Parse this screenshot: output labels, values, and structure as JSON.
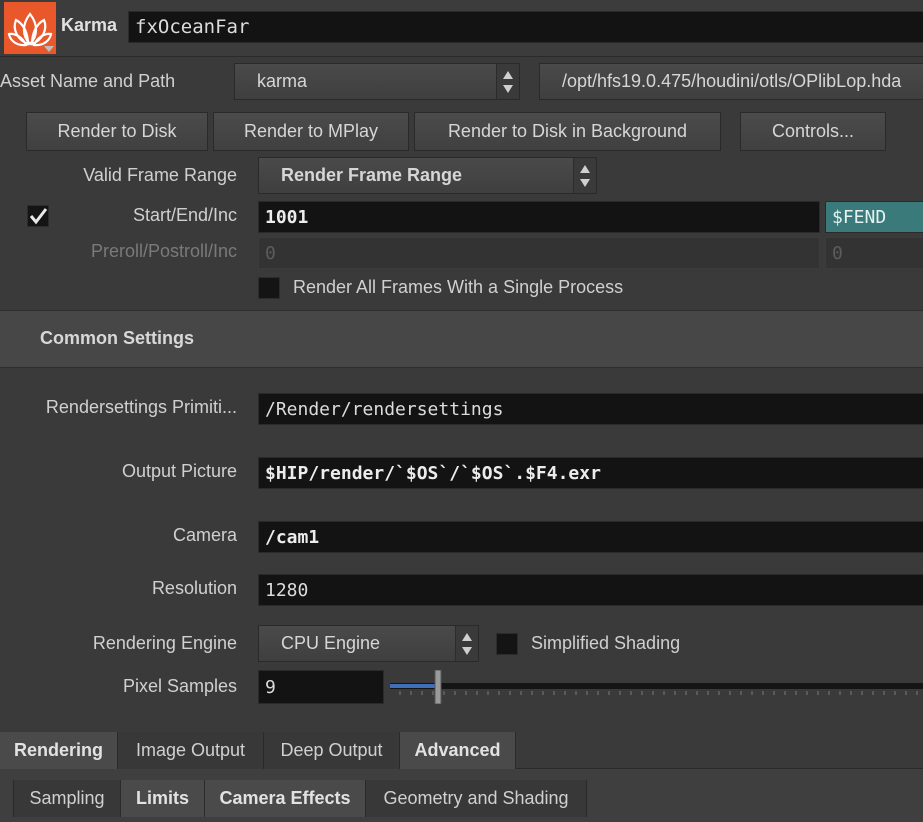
{
  "header": {
    "node_type": "Karma",
    "node_name": "fxOceanFar"
  },
  "asset": {
    "label": "Asset Name and Path",
    "selected": "karma",
    "path": "/opt/hfs19.0.475/houdini/otls/OPlibLop.hda"
  },
  "buttons": {
    "render_to_disk": "Render to Disk",
    "render_to_mplay": "Render to MPlay",
    "render_bg": "Render to Disk in Background",
    "controls": "Controls..."
  },
  "frame_range": {
    "label": "Valid Frame Range",
    "selected": "Render Frame Range",
    "start_label": "Start/End/Inc",
    "start_value": "1001",
    "end_value": "$FEND",
    "preroll_label": "Preroll/Postroll/Inc",
    "preroll_value": "0",
    "postroll_value": "0",
    "single_process_label": "Render All Frames With a Single Process"
  },
  "common": {
    "section_title": "Common Settings",
    "rendersettings_label": "Rendersettings Primiti...",
    "rendersettings_value": "/Render/rendersettings",
    "output_label": "Output Picture",
    "output_value": "$HIP/render/`$OS`/`$OS`.$F4.exr",
    "camera_label": "Camera",
    "camera_value": "/cam1",
    "resolution_label": "Resolution",
    "resolution_value": "1280",
    "engine_label": "Rendering Engine",
    "engine_selected": "CPU Engine",
    "simplified_label": "Simplified Shading",
    "pixel_samples_label": "Pixel Samples",
    "pixel_samples_value": "9",
    "pixel_samples_fraction": 0.09
  },
  "tabs": [
    {
      "label": "Rendering",
      "active": true
    },
    {
      "label": "Image Output",
      "active": false
    },
    {
      "label": "Deep Output",
      "active": false
    },
    {
      "label": "Advanced",
      "active": true
    }
  ],
  "subtabs": [
    {
      "label": "Sampling",
      "active": false
    },
    {
      "label": "Limits",
      "active": true
    },
    {
      "label": "Camera Effects",
      "active": true
    },
    {
      "label": "Geometry and Shading",
      "active": false
    }
  ],
  "colors": {
    "accent": "#e8582a",
    "end_field": "#3a7a7a",
    "slider_fill": "#3f6fb8"
  }
}
